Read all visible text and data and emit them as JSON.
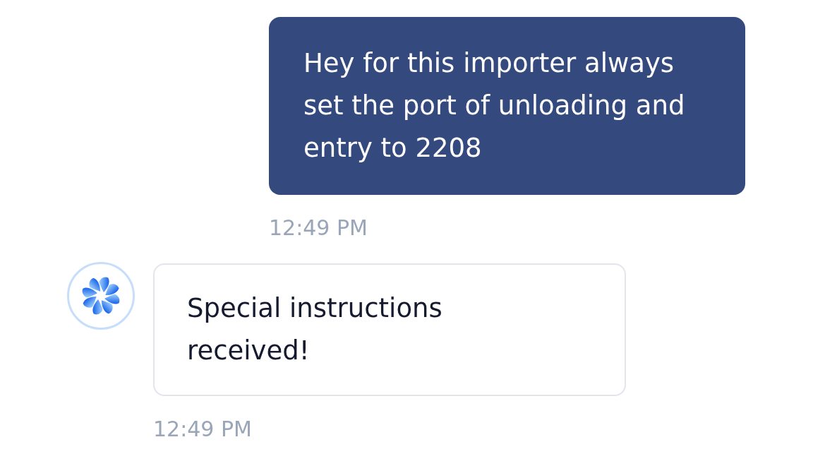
{
  "messages": [
    {
      "kind": "outgoing",
      "text": "Hey for this importer always set the port of unloading and entry to 2208",
      "time": "12:49 PM"
    },
    {
      "kind": "incoming",
      "text": "Special instructions received!",
      "time": "12:49 PM"
    }
  ]
}
